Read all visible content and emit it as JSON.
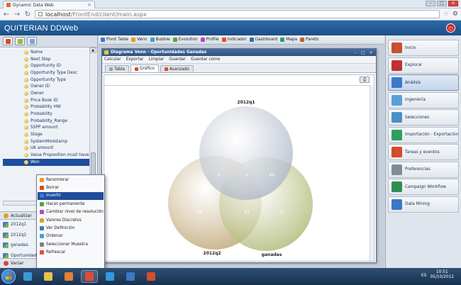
{
  "browser": {
    "tab_title": "Dynamic Data Web",
    "url_host": "localhost",
    "url_path": "/FrontEnd/client/main.aspx"
  },
  "app": {
    "title": "QUITERIAN DDWeb"
  },
  "fields": [
    "Name",
    "Next Step",
    "Opportunity ID",
    "Opportunity Type Desc",
    "Opportunity Type",
    "Owner ID",
    "Owner",
    "Price Book ID",
    "Probability HW",
    "Probability",
    "Probability_Range",
    "SSPP amount",
    "Stage",
    "SystemModstamp",
    "UK amount",
    "Value Proposition must have",
    "Won"
  ],
  "selected_field": "Won",
  "update_label": "Actualizar",
  "sets": [
    "2012q1",
    "2012q2",
    "ganadas",
    "Oportunidades",
    "Venn Segmento"
  ],
  "selected_set": "Venn Segmento",
  "bottom_label": "Vaciar",
  "toolbar": [
    {
      "label": "Pivot Table",
      "color": "#3d78c8"
    },
    {
      "label": "Venn",
      "color": "#e0a020"
    },
    {
      "label": "Bubble",
      "color": "#44a0c8"
    },
    {
      "label": "Evolution",
      "color": "#5f9f40"
    },
    {
      "label": "Profile",
      "color": "#b04ac0"
    },
    {
      "label": "Indicador",
      "color": "#e05030"
    },
    {
      "label": "Dashboard",
      "color": "#3a68b0"
    },
    {
      "label": "Mapa",
      "color": "#2e9e60"
    },
    {
      "label": "Pareto",
      "color": "#c06030"
    }
  ],
  "venn_window": {
    "title": "Diagrama Venn - Oportunidades Ganadas",
    "menu": [
      "Calcular",
      "Exportar",
      "Limpiar",
      "Guardar",
      "Guardar como"
    ],
    "tabs": [
      {
        "label": "Tabla",
        "active": false
      },
      {
        "label": "Gráfico",
        "active": true
      },
      {
        "label": "Avanzado",
        "active": false
      }
    ]
  },
  "chart_data": {
    "type": "venn",
    "sets": [
      {
        "name": "2012q1",
        "only": 17,
        "color": "#a9b3c4"
      },
      {
        "name": "2012q2",
        "only": 58,
        "color": "#b99f6a"
      },
      {
        "name": "ganadas",
        "only": 13,
        "color": "#a8b46a"
      }
    ],
    "intersections": [
      {
        "sets": [
          "2012q1",
          "2012q2"
        ],
        "value": 0
      },
      {
        "sets": [
          "2012q1",
          "ganadas"
        ],
        "value": 49
      },
      {
        "sets": [
          "2012q2",
          "ganadas"
        ],
        "value": 27
      },
      {
        "sets": [
          "2012q1",
          "2012q2",
          "ganadas"
        ],
        "value": 0
      }
    ]
  },
  "context_menu": [
    {
      "label": "Renombrar",
      "color": "#e0a020"
    },
    {
      "label": "Borrar",
      "color": "#d54a2b"
    },
    {
      "label": "Invertir",
      "color": "#3d78c8",
      "highlighted": true
    },
    {
      "label": "Hacer permanente",
      "color": "#5f9f40"
    },
    {
      "label": "Cambiar nivel de resolución",
      "color": "#b04ac0"
    },
    {
      "label": "Valores Discretos",
      "color": "#e0a020"
    },
    {
      "label": "Ver Definición",
      "color": "#3d78c8"
    },
    {
      "label": "Ordenar",
      "color": "#44a0c8"
    },
    {
      "label": "Seleccionar Muestra",
      "color": "#7f7f7f"
    },
    {
      "label": "Refrescar",
      "color": "#e05030"
    }
  ],
  "right_nav": [
    {
      "label": "Inicio",
      "color": "#c85030",
      "icon": "home-icon"
    },
    {
      "label": "Explorar",
      "color": "#c03030",
      "icon": "explore-icon"
    },
    {
      "label": "Análisis",
      "color": "#3d78c8",
      "icon": "analysis-icon",
      "active": true
    },
    {
      "label": "Ingeniería",
      "color": "#5aa0d8",
      "icon": "engineering-icon"
    },
    {
      "label": "Selecciones",
      "color": "#4a90c8",
      "icon": "selections-icon"
    },
    {
      "label": "Importación - Exportación",
      "color": "#2e9e60",
      "icon": "import-export-icon"
    },
    {
      "label": "Tareas y eventos",
      "color": "#d54a2b",
      "icon": "tasks-icon"
    },
    {
      "label": "Preferencias",
      "color": "#7f8c9a",
      "icon": "preferences-icon"
    },
    {
      "label": "Campaign Workflow",
      "color": "#2e8e50",
      "icon": "workflow-icon"
    },
    {
      "label": "Data Mining",
      "color": "#3a78c8",
      "icon": "data-mining-icon"
    }
  ],
  "taskbar": {
    "apps": [
      {
        "name": "ie-app-icon",
        "color": "#3a9ad8"
      },
      {
        "name": "explorer-app-icon",
        "color": "#e8c050"
      },
      {
        "name": "media-player-app-icon",
        "color": "#e0803a"
      },
      {
        "name": "chrome-app-icon",
        "color": "#e04a3a",
        "active": true
      },
      {
        "name": "skype-app-icon",
        "color": "#2e9ae0"
      },
      {
        "name": "network-app-icon",
        "color": "#3a78c8"
      },
      {
        "name": "powerpoint-app-icon",
        "color": "#d0502a"
      }
    ],
    "lang": "ES",
    "time": "10:51",
    "date": "05/10/2012"
  }
}
